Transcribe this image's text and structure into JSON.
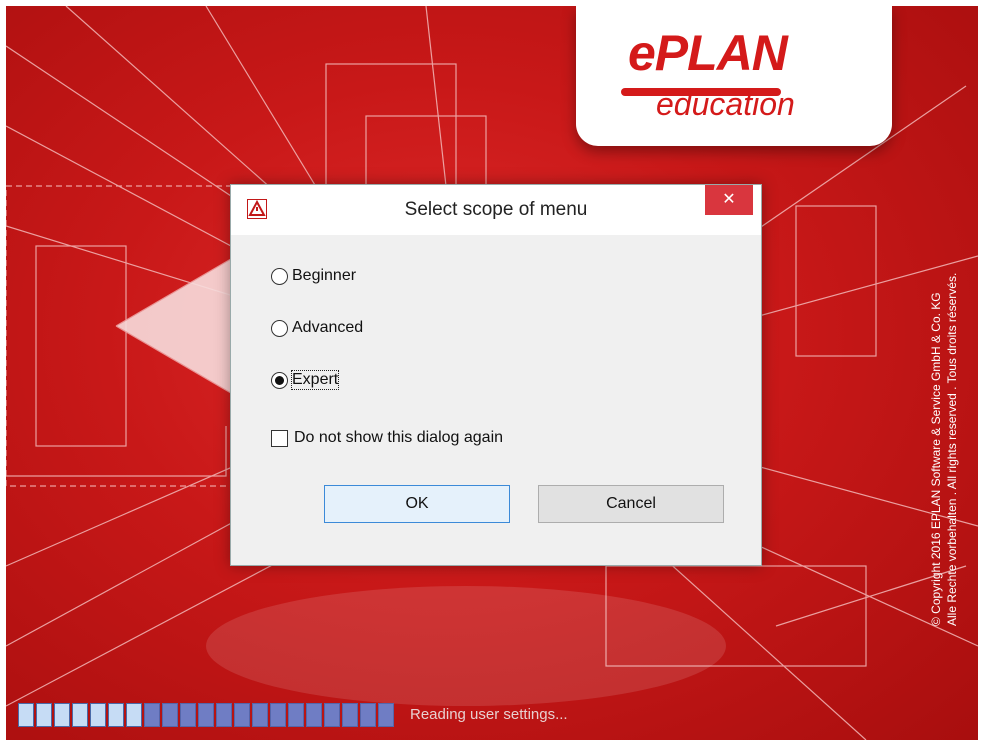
{
  "dialog": {
    "title": "Select scope of menu",
    "close_glyph": "✕",
    "options": [
      {
        "label": "Beginner",
        "checked": false
      },
      {
        "label": "Advanced",
        "checked": false
      },
      {
        "label": "Expert",
        "checked": true
      }
    ],
    "checkbox_label": "Do not show this dialog again",
    "checkbox_checked": false,
    "ok_label": "OK",
    "cancel_label": "Cancel"
  },
  "splash": {
    "logo_brand": "ePLAN",
    "logo_sub": "education",
    "copyright_line1": "© Copyright 2016 EPLAN Software & Service GmbH & Co. KG",
    "copyright_line2": "Alle Rechte vorbehalten . All rights reserved . Tous droits réservés.",
    "status_text": "Reading user settings...",
    "progress": 0.33,
    "progress_segments": 21,
    "accent_color": "#c81818"
  }
}
